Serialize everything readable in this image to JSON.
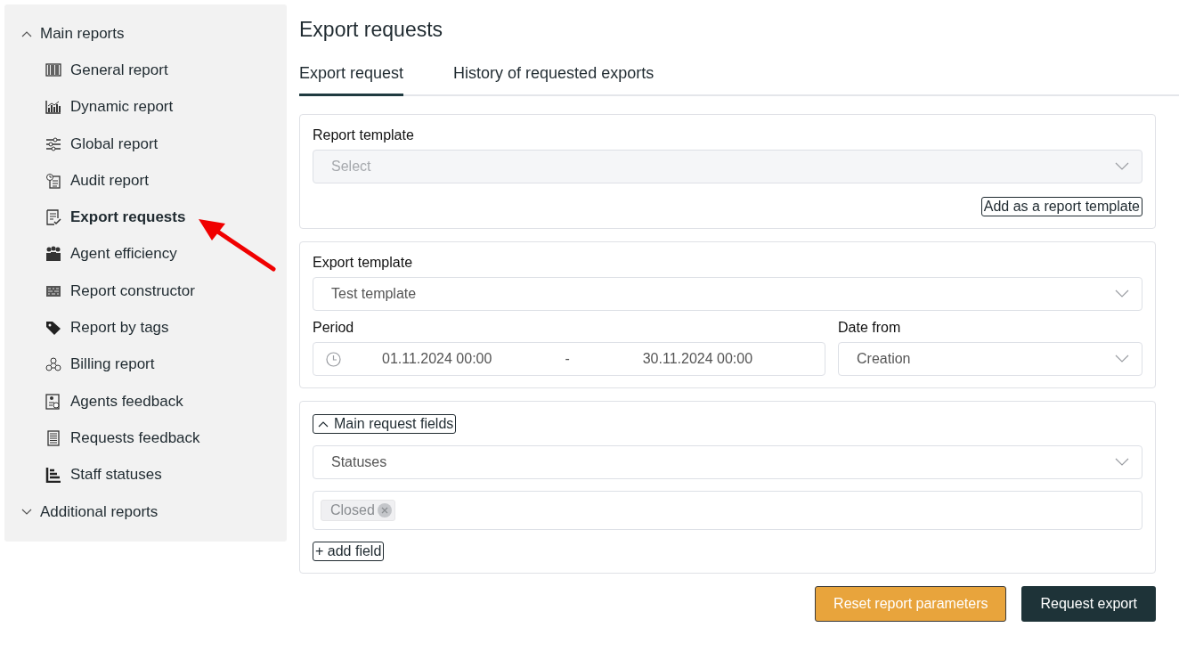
{
  "sidebar": {
    "groups": [
      {
        "label": "Main reports",
        "expanded": true,
        "items": [
          {
            "label": "General report",
            "selected": false
          },
          {
            "label": "Dynamic report",
            "selected": false
          },
          {
            "label": "Global report",
            "selected": false
          },
          {
            "label": "Audit report",
            "selected": false
          },
          {
            "label": "Export requests",
            "selected": true
          },
          {
            "label": "Agent efficiency",
            "selected": false
          },
          {
            "label": "Report constructor",
            "selected": false
          },
          {
            "label": "Report by tags",
            "selected": false
          },
          {
            "label": "Billing report",
            "selected": false
          },
          {
            "label": "Agents feedback",
            "selected": false
          },
          {
            "label": "Requests feedback",
            "selected": false
          },
          {
            "label": "Staff statuses",
            "selected": false
          }
        ]
      },
      {
        "label": "Additional reports",
        "expanded": false
      }
    ]
  },
  "page_title": "Export requests",
  "tabs": [
    {
      "label": "Export request",
      "selected": true
    },
    {
      "label": "History of requested exports",
      "selected": false
    }
  ],
  "report_template_card": {
    "label": "Report template",
    "select": {
      "placeholder": "Select",
      "disabled": true
    },
    "button": "Add as a report template"
  },
  "export_card": {
    "export_template": {
      "label": "Export template",
      "value": "Test template"
    },
    "period": {
      "label": "Period",
      "from": "01.11.2024 00:00",
      "separator": "-",
      "to": "30.11.2024 00:00"
    },
    "date_from": {
      "label": "Date from",
      "value": "Creation"
    }
  },
  "fields_card": {
    "section": {
      "label": "Main request fields",
      "expanded": true
    },
    "fields": [
      {
        "select": "Statuses",
        "tags": [
          "Closed"
        ]
      }
    ],
    "add_button": "+ add field"
  },
  "actions": [
    {
      "label": "Reset report parameters",
      "kind": "secondary"
    },
    {
      "label": "Request export",
      "kind": "primary"
    }
  ]
}
